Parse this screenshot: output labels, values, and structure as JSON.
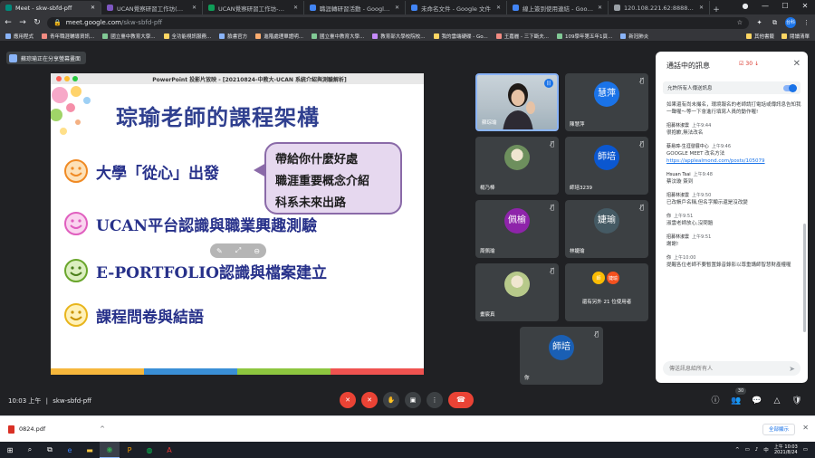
{
  "browser": {
    "tabs": [
      {
        "title": "Meet - skw-sbfd-pff",
        "favicon_color": "#00897b",
        "active": true
      },
      {
        "title": "UCAN覺察研習工作坊(優/劣)",
        "favicon_color": "#7e57c2",
        "active": false
      },
      {
        "title": "UCAN覺察研習工作坊-職業興",
        "favicon_color": "#0f9d58",
        "active": false
      },
      {
        "title": "職涯轉研習活動 - Google 影",
        "favicon_color": "#4285f4",
        "active": false
      },
      {
        "title": "未命名文件 - Google 文件",
        "favicon_color": "#4285f4",
        "active": false
      },
      {
        "title": "線上簽到使用連結 - Google 文",
        "favicon_color": "#4285f4",
        "active": false
      },
      {
        "title": "120.108.221.62:8888/SysMen",
        "favicon_color": "#9aa0a6",
        "active": false
      }
    ],
    "new_tab_symbol": "+",
    "window_controls": [
      "●",
      "—",
      "☐",
      "✕"
    ],
    "url_domain": "meet.google.com",
    "url_path": "/skw-sbfd-pff",
    "profile_label": "台科",
    "bookmarks": [
      "應用程式",
      "青年職涯輔導資訊...",
      "國立臺中教育大學...",
      "全功能視訊服務...",
      "臉書官方",
      "進階處理單證明...",
      "國立臺中教育大學...",
      "教育部大學校院校...",
      "我的雲端硬碟 - Go...",
      "王嘉麗 - 三下斷夫...",
      "109學年第五年1頁...",
      "新冠肺炎"
    ],
    "bookmarks_right": [
      "其他書籤",
      "閱讀清單"
    ]
  },
  "meet": {
    "presenter_label": "蘇琮瑜正在分享螢幕畫面",
    "meeting_time": "10:03 上午",
    "meeting_code": "skw-sbfd-pff",
    "participant_count": "30",
    "participants": [
      {
        "name": "蘇琮瑜",
        "type": "self",
        "initial": ""
      },
      {
        "name": "陳慧萍",
        "type": "avatar",
        "initial": "慧萍",
        "color": "#1a73e8"
      },
      {
        "name": "楊乃棒",
        "type": "photo",
        "initial": "",
        "color": "#6d8f5d"
      },
      {
        "name": "師培3239",
        "type": "avatar",
        "initial": "師培",
        "color": "#0b57d0"
      },
      {
        "name": "周佩瑜",
        "type": "avatar",
        "initial": "佩榆",
        "color": "#8e24aa"
      },
      {
        "name": "林婕瑜",
        "type": "avatar",
        "initial": "婕瑜",
        "color": "#455a64"
      },
      {
        "name": "畫宸真",
        "type": "photo",
        "initial": "",
        "color": "#b7c98a"
      },
      {
        "name": "還有另外 21 位使用者",
        "type": "others",
        "initial": "",
        "color": ""
      },
      {
        "name": "你",
        "type": "avatar",
        "initial": "師培",
        "color": "#1a5fb4"
      }
    ],
    "others_avatar_labels": [
      "師",
      "婕瑜"
    ]
  },
  "slideshow": {
    "window_title": "PowerPoint 投影片放映 - [20210824-中教大-UCAN 系統介紹與測驗解析]",
    "heading": "琮瑜老師的課程架構",
    "bullets": [
      "大學「從心」出發",
      "UCAN平台認識與職業興趣測驗",
      "E-PORTFOLIO認識與檔案建立",
      "課程問卷與結語"
    ],
    "callout_lines": [
      "帶給你什麼好處",
      "職涯重要概念介紹",
      "科系未來出路"
    ],
    "controls": [
      "✎",
      "⤢",
      "⊖"
    ],
    "stripe_colors": [
      "#f6b73c",
      "#3a8fd6",
      "#8dc63f",
      "#ef5350"
    ]
  },
  "chat": {
    "title": "通話中的訊息",
    "notify_count": "30",
    "toggle_label": "允許所有人傳送訊息",
    "messages": [
      {
        "sender": "",
        "time": "",
        "text": "如果還有尚未撮名，環境報名的老師請打電話或傳訊息告知我一聲喔～等一下會進行填寫人員的動作喔!"
      },
      {
        "sender": "招募林淑雲",
        "time": "上午9:44",
        "text": "很抱歉,無法改名"
      },
      {
        "sender": "蔡易璋-生涯發展中心",
        "time": "上午9:46",
        "text": "GOOGLE MEET 改名方法",
        "link": "https://applealmond.com/posts/105079"
      },
      {
        "sender": "Hsuan Tsai",
        "time": "上午9:48",
        "text": "蔡汶璇 簽到"
      },
      {
        "sender": "招募林淑雲",
        "time": "上午9:50",
        "text": "已改帳戶名稱,但名字顯示還是沒改變"
      },
      {
        "sender": "你",
        "time": "上午9:51",
        "text": "淑雲老師放心,沒問題"
      },
      {
        "sender": "招募林淑雲",
        "time": "上午9:51",
        "text": "謝謝!"
      },
      {
        "sender": "你",
        "time": "上午10:00",
        "text": "提醒各位老師不要暫置錄音錄影以尊重講師智慧財產權喔"
      }
    ],
    "input_placeholder": "傳送訊息給所有人",
    "send_symbol": "➤"
  },
  "controls": {
    "mic": "✕",
    "camera": "✕",
    "hand": "✋",
    "present": "▣",
    "more": "⋮",
    "hangup": "☎",
    "info": "ⓘ",
    "people": "👥",
    "chat": "💬",
    "activities": "△",
    "security": "🛡"
  },
  "download": {
    "filename": "0824.pdf",
    "caret": "^",
    "show_all": "全部顯示",
    "close": "✕"
  },
  "taskbar": {
    "clock_time": "上午 10:03",
    "clock_date": "2021/8/24",
    "ime": "中",
    "tray": [
      "^",
      "▭",
      "♪"
    ]
  }
}
